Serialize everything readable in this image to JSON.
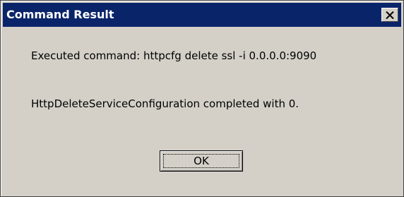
{
  "window": {
    "title": "Command Result",
    "close_icon": "close-x-icon"
  },
  "message": {
    "line1": "Executed command: httpcfg delete ssl -i 0.0.0.0:9090",
    "line2": "HttpDeleteServiceConfiguration completed with 0."
  },
  "buttons": {
    "ok_label": "OK"
  },
  "colors": {
    "titlebar": "#0a246a",
    "face": "#d4d0c8"
  }
}
